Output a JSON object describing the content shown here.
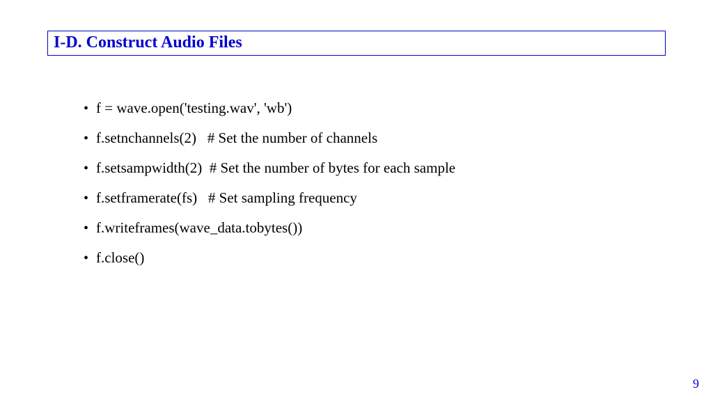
{
  "title": "I-D.  Construct Audio Files",
  "items": [
    "f = wave.open('testing.wav', 'wb')",
    "f.setnchannels(2)   # Set the number of channels",
    "f.setsampwidth(2)  # Set the number of bytes for each sample",
    "f.setframerate(fs)   # Set sampling frequency",
    "f.writeframes(wave_data.tobytes())",
    "f.close()"
  ],
  "page_number": "9"
}
